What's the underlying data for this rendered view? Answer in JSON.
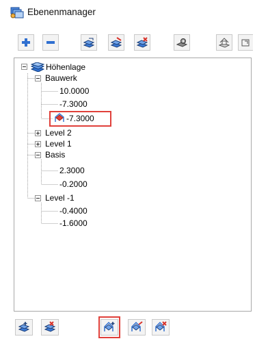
{
  "window": {
    "title": "Ebenenmanager",
    "icon": "layer-manager-icon"
  },
  "toolbar": {
    "buttons": [
      {
        "icon": "add-plus-icon"
      },
      {
        "icon": "remove-minus-icon"
      },
      {
        "icon": "layer-edit-icon"
      },
      {
        "icon": "layer-edit-red-icon"
      },
      {
        "icon": "layer-delete-icon"
      },
      {
        "icon": "layer-settings-icon"
      },
      {
        "icon": "layer-export-icon"
      },
      {
        "icon": "layer-import-icon"
      }
    ]
  },
  "tree": {
    "root": {
      "label": "Höhenlage",
      "expanded": true,
      "icon": "layer-stack-icon"
    },
    "items": [
      {
        "label": "Bauwerk",
        "level": 1,
        "expanded": true
      },
      {
        "label": "10.0000",
        "level": 2
      },
      {
        "label": "-7.3000",
        "level": 2
      },
      {
        "label": "-7.3000",
        "level": 2,
        "icon": "roof-icon",
        "highlighted": true
      },
      {
        "label": "Level 2",
        "level": 1,
        "expanded": false
      },
      {
        "label": "Level 1",
        "level": 1,
        "expanded": false
      },
      {
        "label": "Basis",
        "level": 1,
        "expanded": true
      },
      {
        "label": "2.3000",
        "level": 2
      },
      {
        "label": "-0.2000",
        "level": 2
      },
      {
        "label": "Level -1",
        "level": 1,
        "expanded": true
      },
      {
        "label": "-0.4000",
        "level": 2
      },
      {
        "label": "-1.6000",
        "level": 2
      }
    ]
  },
  "bottombar": {
    "buttons": [
      {
        "icon": "layer-add-icon"
      },
      {
        "icon": "layer-remove-icon"
      },
      {
        "icon": "roof-add-icon",
        "highlighted": true
      },
      {
        "icon": "roof-edit-icon"
      },
      {
        "icon": "roof-delete-icon"
      }
    ]
  },
  "colors": {
    "highlight": "#e0403a",
    "icon_blue": "#2f6fd0",
    "icon_red": "#d9332b"
  }
}
